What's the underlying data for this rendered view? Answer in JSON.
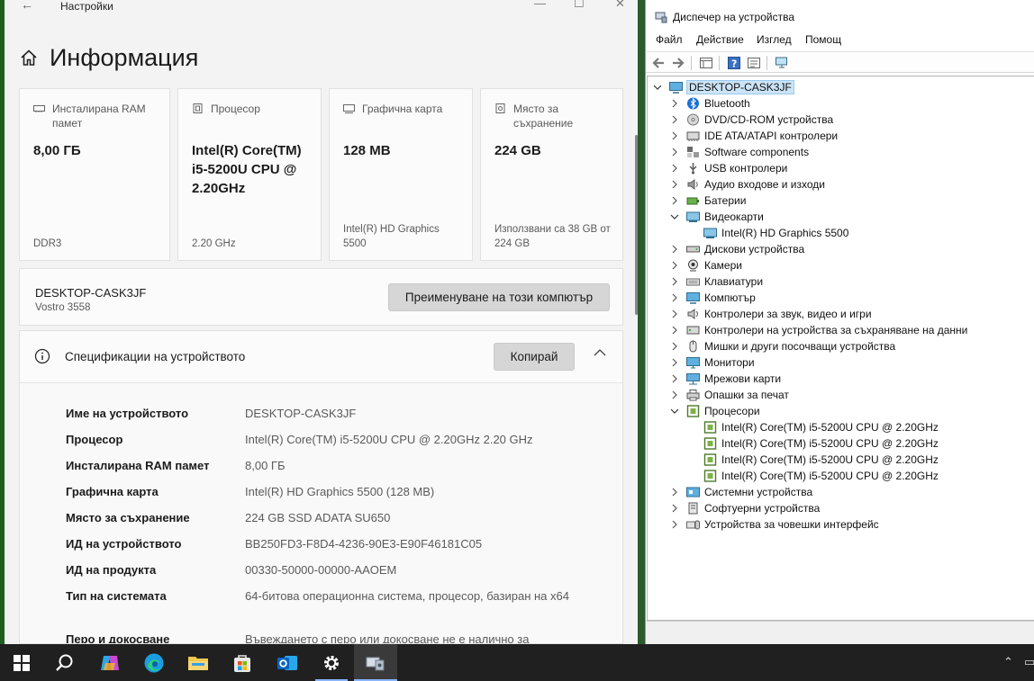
{
  "settings": {
    "window_title": "Настройки",
    "page_title": "Информация",
    "cards": [
      {
        "label": "Инсталирана RAM памет",
        "value": "8,00 ГБ",
        "sub": "DDR3",
        "icon": "memory-icon"
      },
      {
        "label": "Процесор",
        "value": "Intel(R) Core(TM) i5-5200U CPU @ 2.20GHz",
        "sub": "2.20 GHz",
        "icon": "cpu-icon"
      },
      {
        "label": "Графична карта",
        "value": "128 MB",
        "sub": "Intel(R) HD Graphics 5500",
        "icon": "gpu-icon"
      },
      {
        "label": "Място за съхранение",
        "value": "224 GB",
        "sub": "Използвани са 38 GB от 224 GB",
        "icon": "storage-icon"
      }
    ],
    "device": {
      "name": "DESKTOP-CASK3JF",
      "model": "Vostro 3558",
      "rename_label": "Преименуване на този компютър"
    },
    "specs": {
      "title": "Спецификации на устройството",
      "copy_label": "Копирай",
      "rows": [
        {
          "k": "Име на устройството",
          "v": "DESKTOP-CASK3JF"
        },
        {
          "k": "Процесор",
          "v": "Intel(R) Core(TM) i5-5200U CPU @ 2.20GHz   2.20 GHz"
        },
        {
          "k": "Инсталирана RAM памет",
          "v": "8,00 ГБ"
        },
        {
          "k": "Графична карта",
          "v": "Intel(R) HD Graphics 5500 (128 MB)"
        },
        {
          "k": "Място за съхранение",
          "v": "224 GB SSD ADATA SU650"
        },
        {
          "k": "ИД на устройството",
          "v": "BB250FD3-F8D4-4236-90E3-E90F46181C05"
        },
        {
          "k": "ИД на продукта",
          "v": "00330-50000-00000-AAOEM"
        },
        {
          "k": "Тип на системата",
          "v": "64-битова операционна система, процесор, базиран на x64"
        },
        {
          "k": "Перо и докосване",
          "v": "Въвеждането с перо или докосване не е налично за"
        }
      ]
    }
  },
  "devmgr": {
    "title": "Диспечер на устройства",
    "menu": [
      "Файл",
      "Действие",
      "Изглед",
      "Помощ"
    ],
    "root": "DESKTOP-CASK3JF",
    "nodes": [
      {
        "t": "Bluetooth",
        "lvl": 1,
        "exp": "collapsed",
        "icon": "bluetooth-icon"
      },
      {
        "t": "DVD/CD-ROM устройства",
        "lvl": 1,
        "exp": "collapsed",
        "icon": "dvd-drive-icon"
      },
      {
        "t": "IDE ATA/ATAPI контролери",
        "lvl": 1,
        "exp": "collapsed",
        "icon": "ide-controller-icon"
      },
      {
        "t": "Software components",
        "lvl": 1,
        "exp": "collapsed",
        "icon": "software-component-icon"
      },
      {
        "t": "USB контролери",
        "lvl": 1,
        "exp": "collapsed",
        "icon": "usb-icon"
      },
      {
        "t": "Аудио входове и изходи",
        "lvl": 1,
        "exp": "collapsed",
        "icon": "speaker-icon"
      },
      {
        "t": "Батерии",
        "lvl": 1,
        "exp": "collapsed",
        "icon": "battery-icon"
      },
      {
        "t": "Видеокарти",
        "lvl": 1,
        "exp": "expanded",
        "icon": "display-adapter-icon"
      },
      {
        "t": "Intel(R) HD Graphics 5500",
        "lvl": 2,
        "exp": "none",
        "icon": "display-adapter-icon"
      },
      {
        "t": "Дискови устройства",
        "lvl": 1,
        "exp": "collapsed",
        "icon": "disk-drive-icon"
      },
      {
        "t": "Камери",
        "lvl": 1,
        "exp": "collapsed",
        "icon": "camera-icon"
      },
      {
        "t": "Клавиатури",
        "lvl": 1,
        "exp": "collapsed",
        "icon": "keyboard-icon"
      },
      {
        "t": "Компютър",
        "lvl": 1,
        "exp": "collapsed",
        "icon": "computer-icon"
      },
      {
        "t": "Контролери за звук, видео и игри",
        "lvl": 1,
        "exp": "collapsed",
        "icon": "sound-icon"
      },
      {
        "t": "Контролери на устройства за съхраняване на данни",
        "lvl": 1,
        "exp": "collapsed",
        "icon": "storage-controller-icon"
      },
      {
        "t": "Мишки и други посочващи устройства",
        "lvl": 1,
        "exp": "collapsed",
        "icon": "mouse-icon"
      },
      {
        "t": "Монитори",
        "lvl": 1,
        "exp": "collapsed",
        "icon": "monitor-icon"
      },
      {
        "t": "Мрежови карти",
        "lvl": 1,
        "exp": "collapsed",
        "icon": "network-adapter-icon"
      },
      {
        "t": "Опашки за печат",
        "lvl": 1,
        "exp": "collapsed",
        "icon": "printer-icon"
      },
      {
        "t": "Процесори",
        "lvl": 1,
        "exp": "expanded",
        "icon": "processor-icon"
      },
      {
        "t": "Intel(R) Core(TM) i5-5200U CPU @ 2.20GHz",
        "lvl": 2,
        "exp": "none",
        "icon": "processor-icon"
      },
      {
        "t": "Intel(R) Core(TM) i5-5200U CPU @ 2.20GHz",
        "lvl": 2,
        "exp": "none",
        "icon": "processor-icon"
      },
      {
        "t": "Intel(R) Core(TM) i5-5200U CPU @ 2.20GHz",
        "lvl": 2,
        "exp": "none",
        "icon": "processor-icon"
      },
      {
        "t": "Intel(R) Core(TM) i5-5200U CPU @ 2.20GHz",
        "lvl": 2,
        "exp": "none",
        "icon": "processor-icon"
      },
      {
        "t": "Системни устройства",
        "lvl": 1,
        "exp": "collapsed",
        "icon": "system-device-icon"
      },
      {
        "t": "Софтуерни устройства",
        "lvl": 1,
        "exp": "collapsed",
        "icon": "software-device-icon"
      },
      {
        "t": "Устройства за човешки интерфейс",
        "lvl": 1,
        "exp": "collapsed",
        "icon": "hid-icon"
      }
    ]
  },
  "taskbar": {
    "items": [
      "start-icon",
      "search-icon",
      "copilot-icon",
      "edge-icon",
      "file-explorer-icon",
      "store-icon",
      "outlook-icon",
      "settings-icon",
      "device-manager-icon"
    ],
    "active": "device-manager-icon"
  },
  "colors": {
    "accent": "#0078d4",
    "selection": "#cce4f7",
    "taskbar": "#202020"
  }
}
